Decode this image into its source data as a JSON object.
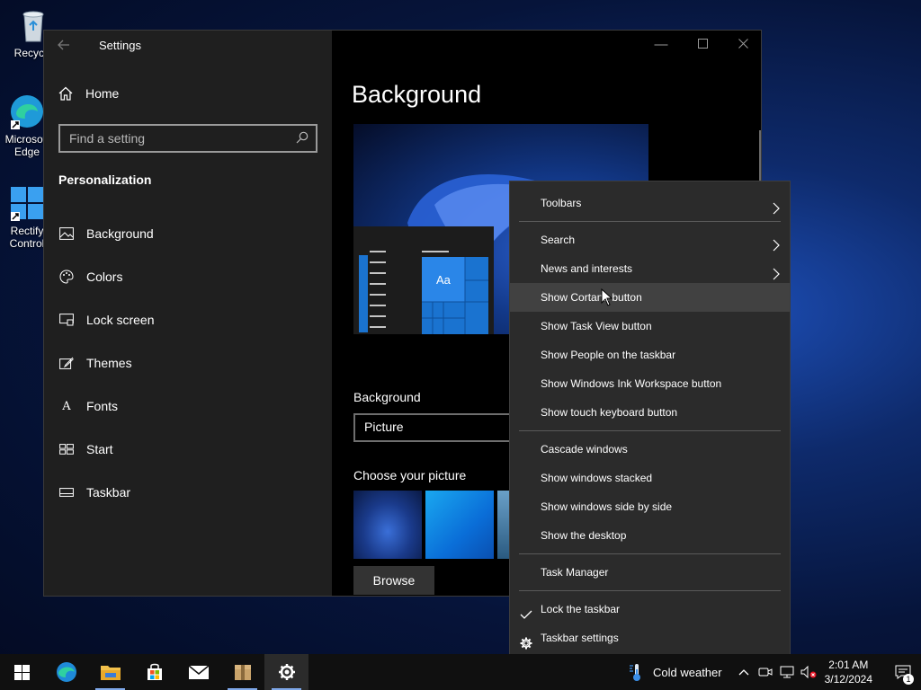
{
  "desktop": {
    "icons": [
      {
        "label": "Recycle",
        "name": "recycle-bin"
      },
      {
        "label": "Microsoft Edge",
        "name": "edge"
      },
      {
        "label": "Rectify Control",
        "name": "rectify"
      }
    ]
  },
  "window": {
    "title": "Settings",
    "home_label": "Home",
    "search_placeholder": "Find a setting",
    "section": "Personalization",
    "nav": [
      {
        "label": "Background",
        "icon": "picture-icon"
      },
      {
        "label": "Colors",
        "icon": "palette-icon"
      },
      {
        "label": "Lock screen",
        "icon": "lock-screen-icon"
      },
      {
        "label": "Themes",
        "icon": "brush-icon"
      },
      {
        "label": "Fonts",
        "icon": "font-icon"
      },
      {
        "label": "Start",
        "icon": "start-icon"
      },
      {
        "label": "Taskbar",
        "icon": "taskbar-icon"
      }
    ]
  },
  "content": {
    "heading": "Background",
    "preview_tile_text": "Aa",
    "background_label": "Background",
    "background_value": "Picture",
    "choose_label": "Choose your picture",
    "browse_label": "Browse"
  },
  "context_menu": {
    "group1": [
      {
        "label": "Toolbars",
        "submenu": true
      },
      {
        "label": "Search",
        "submenu": true
      },
      {
        "label": "News and interests",
        "submenu": true
      },
      {
        "label": "Show Cortana button",
        "hover": true
      },
      {
        "label": "Show Task View button"
      },
      {
        "label": "Show People on the taskbar"
      },
      {
        "label": "Show Windows Ink Workspace button"
      },
      {
        "label": "Show touch keyboard button"
      }
    ],
    "group2": [
      {
        "label": "Cascade windows"
      },
      {
        "label": "Show windows stacked"
      },
      {
        "label": "Show windows side by side"
      },
      {
        "label": "Show the desktop"
      }
    ],
    "group3": [
      {
        "label": "Task Manager"
      }
    ],
    "group4": [
      {
        "label": "Lock the taskbar",
        "lead": "checkmark-icon"
      },
      {
        "label": "Taskbar settings",
        "lead": "gear-icon"
      }
    ]
  },
  "taskbar": {
    "weather": "Cold weather",
    "time": "2:01 AM",
    "date": "3/12/2024",
    "notification_count": "1"
  },
  "colors": {
    "accent": "#0078d4",
    "menu_bg": "#2b2b2b",
    "sidebar_bg": "#1f1f1f"
  }
}
